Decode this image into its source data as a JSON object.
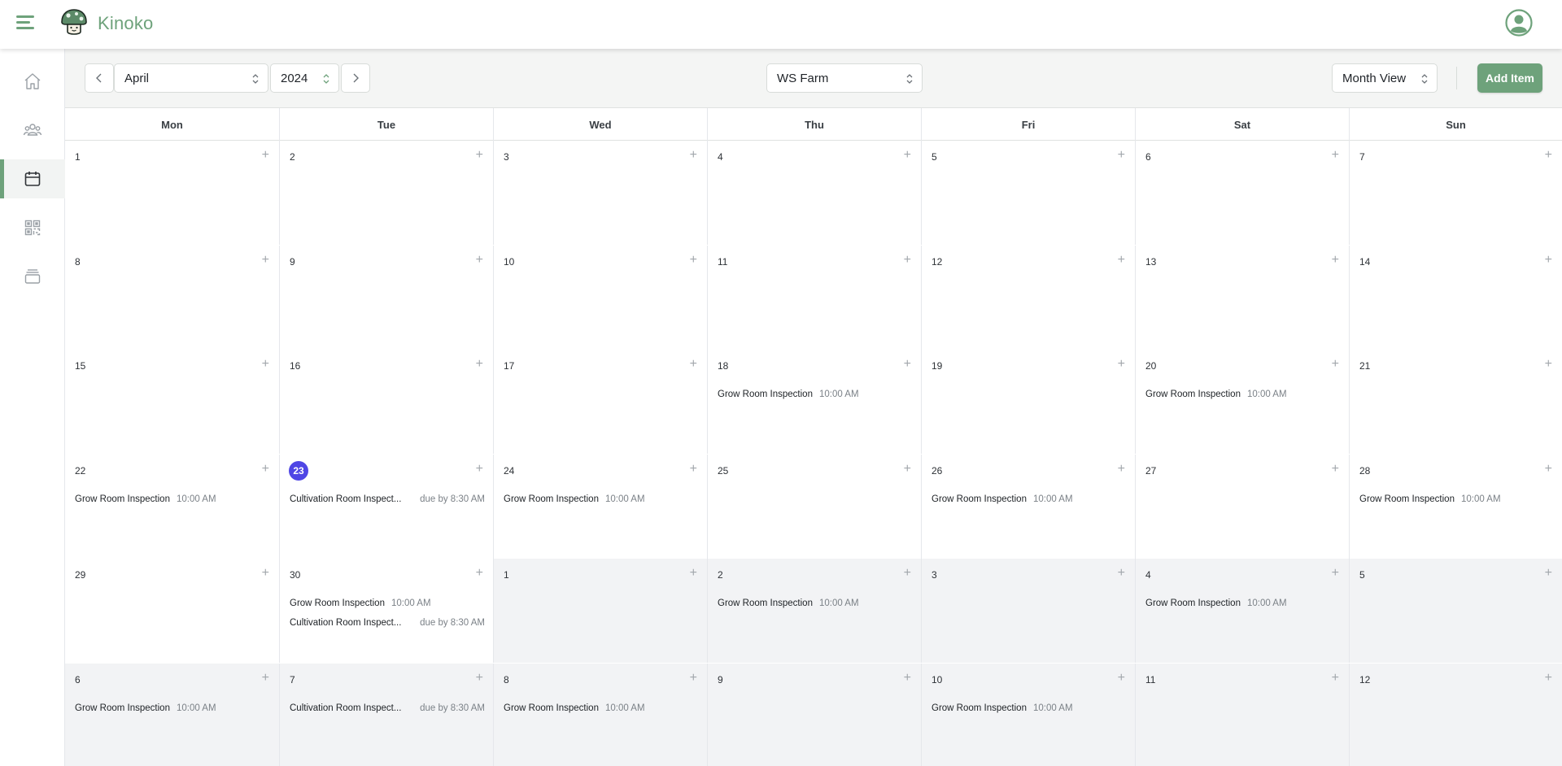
{
  "app": {
    "brand": "Kinoko"
  },
  "colors": {
    "accent": "#6ea27b",
    "today": "#4f46e5"
  },
  "toolbar": {
    "month": "April",
    "year": "2024",
    "farm": "WS Farm",
    "view": "Month View",
    "add_item": "Add Item"
  },
  "sidebar": {
    "items": [
      {
        "icon": "home-icon",
        "active": false
      },
      {
        "icon": "users-icon",
        "active": false
      },
      {
        "icon": "calendar-icon",
        "active": true
      },
      {
        "icon": "qr-code-icon",
        "active": false
      },
      {
        "icon": "inventory-icon",
        "active": false
      }
    ]
  },
  "calendar": {
    "weekdays": [
      "Mon",
      "Tue",
      "Wed",
      "Thu",
      "Fri",
      "Sat",
      "Sun"
    ],
    "weeks": [
      [
        {
          "d": "1",
          "events": []
        },
        {
          "d": "2",
          "events": []
        },
        {
          "d": "3",
          "events": []
        },
        {
          "d": "4",
          "events": []
        },
        {
          "d": "5",
          "events": []
        },
        {
          "d": "6",
          "events": []
        },
        {
          "d": "7",
          "events": []
        }
      ],
      [
        {
          "d": "8",
          "events": []
        },
        {
          "d": "9",
          "events": []
        },
        {
          "d": "10",
          "events": []
        },
        {
          "d": "11",
          "events": []
        },
        {
          "d": "12",
          "events": []
        },
        {
          "d": "13",
          "events": []
        },
        {
          "d": "14",
          "events": []
        }
      ],
      [
        {
          "d": "15",
          "events": []
        },
        {
          "d": "16",
          "events": []
        },
        {
          "d": "17",
          "events": []
        },
        {
          "d": "18",
          "events": [
            {
              "name": "Grow Room Inspection",
              "time": "10:00 AM"
            }
          ]
        },
        {
          "d": "19",
          "events": []
        },
        {
          "d": "20",
          "events": [
            {
              "name": "Grow Room Inspection",
              "time": "10:00 AM"
            }
          ]
        },
        {
          "d": "21",
          "events": []
        }
      ],
      [
        {
          "d": "22",
          "events": [
            {
              "name": "Grow Room Inspection",
              "time": "10:00 AM"
            }
          ]
        },
        {
          "d": "23",
          "today": true,
          "events": [
            {
              "name": "Cultivation Room Inspect...",
              "time": "due by 8:30 AM"
            }
          ]
        },
        {
          "d": "24",
          "events": [
            {
              "name": "Grow Room Inspection",
              "time": "10:00 AM"
            }
          ]
        },
        {
          "d": "25",
          "events": []
        },
        {
          "d": "26",
          "events": [
            {
              "name": "Grow Room Inspection",
              "time": "10:00 AM"
            }
          ]
        },
        {
          "d": "27",
          "events": []
        },
        {
          "d": "28",
          "events": [
            {
              "name": "Grow Room Inspection",
              "time": "10:00 AM"
            }
          ]
        }
      ],
      [
        {
          "d": "29",
          "events": []
        },
        {
          "d": "30",
          "events": [
            {
              "name": "Grow Room Inspection",
              "time": "10:00 AM"
            },
            {
              "name": "Cultivation Room Inspect...",
              "time": "due by 8:30 AM"
            }
          ]
        },
        {
          "d": "1",
          "other": true,
          "events": []
        },
        {
          "d": "2",
          "other": true,
          "events": [
            {
              "name": "Grow Room Inspection",
              "time": "10:00 AM"
            }
          ]
        },
        {
          "d": "3",
          "other": true,
          "events": []
        },
        {
          "d": "4",
          "other": true,
          "events": [
            {
              "name": "Grow Room Inspection",
              "time": "10:00 AM"
            }
          ]
        },
        {
          "d": "5",
          "other": true,
          "events": []
        }
      ],
      [
        {
          "d": "6",
          "other": true,
          "events": [
            {
              "name": "Grow Room Inspection",
              "time": "10:00 AM"
            }
          ]
        },
        {
          "d": "7",
          "other": true,
          "events": [
            {
              "name": "Cultivation Room Inspect...",
              "time": "due by 8:30 AM"
            }
          ]
        },
        {
          "d": "8",
          "other": true,
          "events": [
            {
              "name": "Grow Room Inspection",
              "time": "10:00 AM"
            }
          ]
        },
        {
          "d": "9",
          "other": true,
          "events": []
        },
        {
          "d": "10",
          "other": true,
          "events": [
            {
              "name": "Grow Room Inspection",
              "time": "10:00 AM"
            }
          ]
        },
        {
          "d": "11",
          "other": true,
          "events": []
        },
        {
          "d": "12",
          "other": true,
          "events": []
        }
      ]
    ]
  }
}
